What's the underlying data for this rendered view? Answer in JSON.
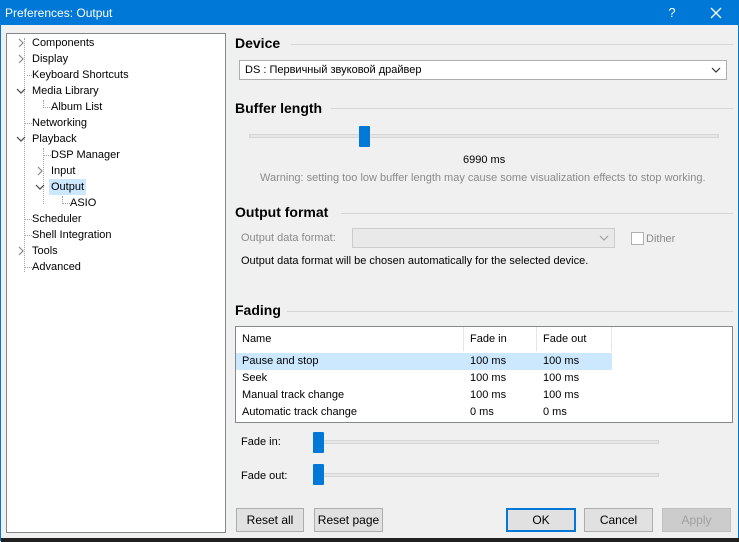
{
  "window": {
    "title": "Preferences: Output",
    "help_label": "?"
  },
  "tree": {
    "items": [
      {
        "label": "Components",
        "expander": "collapsed"
      },
      {
        "label": "Display",
        "expander": "collapsed"
      },
      {
        "label": "Keyboard Shortcuts",
        "expander": "none"
      },
      {
        "label": "Media Library",
        "expander": "expanded"
      },
      {
        "label": "Album List",
        "expander": "none"
      },
      {
        "label": "Networking",
        "expander": "none"
      },
      {
        "label": "Playback",
        "expander": "expanded"
      },
      {
        "label": "DSP Manager",
        "expander": "none"
      },
      {
        "label": "Input",
        "expander": "collapsed"
      },
      {
        "label": "Output",
        "expander": "expanded",
        "selected": true
      },
      {
        "label": "ASIO",
        "expander": "none"
      },
      {
        "label": "Scheduler",
        "expander": "none"
      },
      {
        "label": "Shell Integration",
        "expander": "none"
      },
      {
        "label": "Tools",
        "expander": "collapsed"
      },
      {
        "label": "Advanced",
        "expander": "none"
      }
    ]
  },
  "device": {
    "section_title": "Device",
    "selected": "DS : Первичный звуковой драйвер"
  },
  "buffer": {
    "section_title": "Buffer length",
    "value_text": "6990 ms",
    "slider_fraction": 0.24,
    "warning": "Warning: setting too low buffer length may cause some visualization effects to stop working."
  },
  "output_format": {
    "section_title": "Output format",
    "format_label": "Output data format:",
    "format_value": "",
    "dither_label": "Dither",
    "dither_checked": false,
    "note": "Output data format will be chosen automatically for the selected device."
  },
  "fading": {
    "section_title": "Fading",
    "columns": [
      "Name",
      "Fade in",
      "Fade out"
    ],
    "rows": [
      {
        "name": "Pause and stop",
        "fade_in": "100 ms",
        "fade_out": "100 ms",
        "selected": true
      },
      {
        "name": "Seek",
        "fade_in": "100 ms",
        "fade_out": "100 ms"
      },
      {
        "name": "Manual track change",
        "fade_in": "100 ms",
        "fade_out": "100 ms"
      },
      {
        "name": "Automatic track change",
        "fade_in": "0 ms",
        "fade_out": "0 ms"
      }
    ],
    "fade_in_label": "Fade in:",
    "fade_out_label": "Fade out:",
    "fade_in_fraction": 0.0,
    "fade_out_fraction": 0.0
  },
  "buttons": {
    "reset_all": "Reset all",
    "reset_page": "Reset page",
    "ok": "OK",
    "cancel": "Cancel",
    "apply": "Apply"
  },
  "colors": {
    "accent": "#0078d7",
    "selection": "#cce8ff"
  }
}
